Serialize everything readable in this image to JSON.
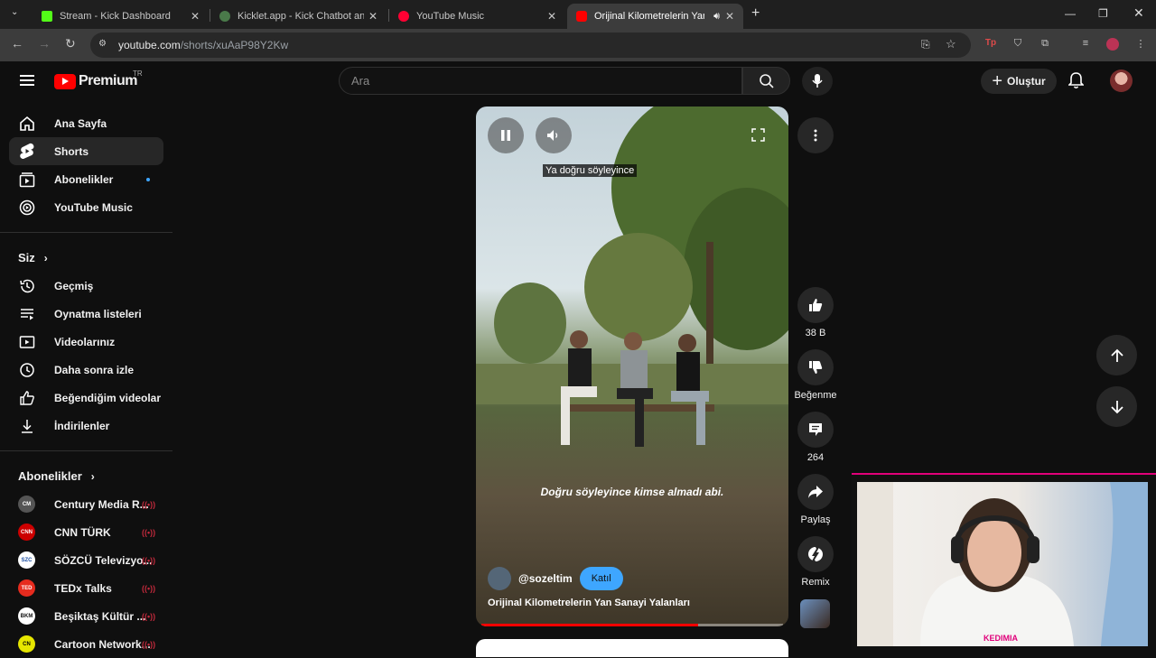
{
  "browser": {
    "tabs": [
      {
        "label": "Stream - Kick Dashboard",
        "fav_color": "#53fc18"
      },
      {
        "label": "Kicklet.app - Kick Chatbot and ...",
        "fav_color": "#4a7a4a"
      },
      {
        "label": "YouTube Music",
        "fav_color": "#ff0033"
      },
      {
        "label": "Orijinal Kilometrelerin Yan Sanayi Yalanları",
        "fav_color": "#ff0000"
      }
    ],
    "url_host": "youtube.com",
    "url_path": "/shorts/xuAaP98Y2Kw"
  },
  "header": {
    "brand": "Premium",
    "region": "TR",
    "search_placeholder": "Ara",
    "create_label": "Oluştur"
  },
  "sidebar": {
    "main": [
      {
        "label": "Ana Sayfa",
        "icon": "home-icon"
      },
      {
        "label": "Shorts",
        "icon": "shorts-icon",
        "selected": true
      },
      {
        "label": "Abonelikler",
        "icon": "subscriptions-icon",
        "dot": true
      },
      {
        "label": "YouTube Music",
        "icon": "youtube-music-icon"
      }
    ],
    "you_title": "Siz",
    "you": [
      {
        "label": "Geçmiş",
        "icon": "history-icon"
      },
      {
        "label": "Oynatma listeleri",
        "icon": "playlists-icon"
      },
      {
        "label": "Videolarınız",
        "icon": "your-videos-icon"
      },
      {
        "label": "Daha sonra izle",
        "icon": "watch-later-icon"
      },
      {
        "label": "Beğendiğim videolar",
        "icon": "liked-icon"
      },
      {
        "label": "İndirilenler",
        "icon": "download-icon"
      }
    ],
    "subs_title": "Abonelikler",
    "subs": [
      {
        "label": "Century Media R...",
        "bg": "#555555",
        "fg": "#ffffff",
        "mark": "CM"
      },
      {
        "label": "CNN TÜRK",
        "bg": "#cc0000",
        "fg": "#ffffff",
        "mark": "CNN"
      },
      {
        "label": "SÖZCÜ Televizyo...",
        "bg": "#ffffff",
        "fg": "#1b4ea3",
        "mark": "SZC"
      },
      {
        "label": "TEDx Talks",
        "bg": "#e62b1e",
        "fg": "#ffffff",
        "mark": "TED"
      },
      {
        "label": "Beşiktaş Kültür ...",
        "bg": "#ffffff",
        "fg": "#111111",
        "mark": "BKM"
      },
      {
        "label": "Cartoon Network...",
        "bg": "#e6e600",
        "fg": "#000000",
        "mark": "CN"
      }
    ]
  },
  "short": {
    "top_caption": "Ya doğru söyleyince",
    "caption": "Doğru söyleyince kimse almadı abi.",
    "channel": "@sozeltim",
    "join_label": "Katıl",
    "title": "Orijinal Kilometrelerin Yan Sanayi Yalanları",
    "progress": 0.72
  },
  "actions": {
    "likes": "38 B",
    "dislike_label": "Beğenme",
    "comments": "264",
    "share_label": "Paylaş",
    "remix_label": "Remix"
  },
  "webcam": {
    "name": "KEDIMIA"
  }
}
